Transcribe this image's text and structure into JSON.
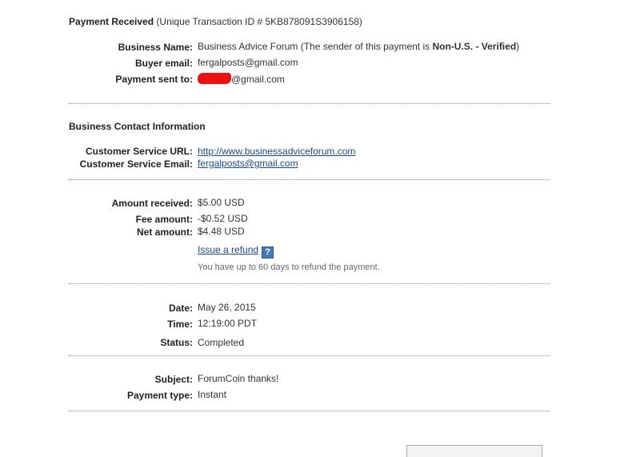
{
  "header": {
    "title": "Payment Received",
    "transaction_text": "(Unique Transaction ID # 5KB878091S3906158)"
  },
  "payment_info": {
    "business_name_label": "Business Name:",
    "business_name_value": "Business Advice Forum (The sender of this payment is ",
    "sender_status": "Non-U.S. - Verified",
    "business_name_close": ")",
    "buyer_email_label": "Buyer email:",
    "buyer_email_value": "fergalposts@gmail.com",
    "sent_to_label": "Payment sent to:",
    "sent_to_value": "@gmail.com"
  },
  "contact": {
    "heading": "Business Contact Information",
    "url_label": "Customer Service URL:",
    "url_value": "http://www.businessadviceforum.com",
    "email_label": "Customer Service Email:",
    "email_value": "fergalposts@gmail.com"
  },
  "amounts": {
    "received_label": "Amount received:",
    "received_value": "$5.00 USD",
    "fee_label": "Fee amount:",
    "fee_value": "-$0.52 USD",
    "net_label": "Net amount:",
    "net_value": "$4.48 USD",
    "refund_link": "Issue a refund",
    "help_icon_glyph": "?",
    "refund_note": "You have up to 60 days to refund the payment."
  },
  "timing": {
    "date_label": "Date:",
    "date_value": "May 26, 2015",
    "time_label": "Time:",
    "time_value": "12:19:00 PDT",
    "status_label": "Status:",
    "status_value": "Completed"
  },
  "details": {
    "subject_label": "Subject:",
    "subject_value": "ForumCoin thanks!",
    "type_label": "Payment type:",
    "type_value": "Instant"
  },
  "colors": {
    "link": "#1a4a8a",
    "redaction": "#ee1111",
    "help_icon": "#4a78b5"
  }
}
